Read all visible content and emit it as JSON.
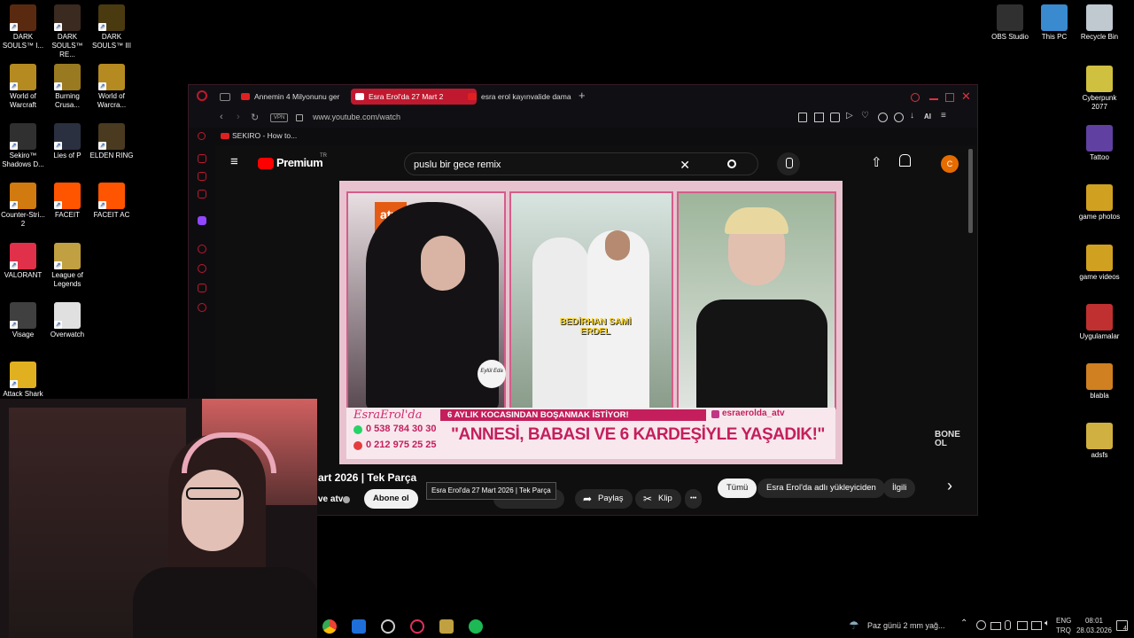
{
  "desktop": {
    "left_icons": [
      {
        "label": "DARK SOULS™ I...",
        "color": "#5a2a10"
      },
      {
        "label": "DARK SOULS™ RE...",
        "color": "#3a2a20"
      },
      {
        "label": "DARK SOULS™ III",
        "color": "#4a3a10"
      },
      {
        "label": "World of Warcraft",
        "color": "#b58a20"
      },
      {
        "label": "Burning Crusa...",
        "color": "#9a7a20"
      },
      {
        "label": "World of Warcra...",
        "color": "#b58a20"
      },
      {
        "label": "Sekiro™ Shadows D...",
        "color": "#303030"
      },
      {
        "label": "Lies of P",
        "color": "#2a3040"
      },
      {
        "label": "ELDEN RING",
        "color": "#4a3a20"
      },
      {
        "label": "Counter-Stri... 2",
        "color": "#d07a10"
      },
      {
        "label": "FACEIT",
        "color": "#ff5500"
      },
      {
        "label": "FACEIT AC",
        "color": "#ff5500"
      },
      {
        "label": "VALORANT",
        "color": "#e0304a"
      },
      {
        "label": "League of Legends",
        "color": "#c0a040"
      },
      {
        "label": "VISAGE",
        "color": "#404040"
      },
      {
        "label": "Visage",
        "color": "#404040"
      },
      {
        "label": "Overwatch",
        "color": "#e0e0e0"
      },
      {
        "label": "Attack Shark",
        "color": "#e0b020"
      }
    ],
    "right_icons": [
      {
        "label": "OBS Studio",
        "color": "#303030"
      },
      {
        "label": "This PC",
        "color": "#3a8ad0"
      },
      {
        "label": "Recycle Bin",
        "color": "#c0c8d0"
      },
      {
        "label": "Cyberpunk 2077",
        "color": "#d0c040"
      },
      {
        "label": "Tattoo",
        "color": "#6040a0"
      },
      {
        "label": "game photos",
        "color": "#d0a020"
      },
      {
        "label": "game videos",
        "color": "#d0a020"
      },
      {
        "label": "Uygulamalar",
        "color": "#c03030"
      },
      {
        "label": "blabla",
        "color": "#d08020"
      },
      {
        "label": "adsfs",
        "color": "#d0b040"
      }
    ]
  },
  "browser": {
    "tabs": [
      {
        "label": "Annemin 4 Milyonunu ger",
        "active": false
      },
      {
        "label": "Esra Erol'da 27 Mart 2",
        "active": true
      },
      {
        "label": "esra erol kayınvalide dama",
        "active": false
      }
    ],
    "new_tab_label": "+",
    "vpn_label": "VPN",
    "url": "www.youtube.com/watch",
    "ai_label": "AI",
    "bookmark": "SEKIRO - How to..."
  },
  "youtube": {
    "logo_text": "Premium",
    "logo_sup": "TR",
    "search_value": "puslu bir gece remix",
    "avatar_letter": "C",
    "video_title": "art 2026 | Tek Parça",
    "channel_name": "ve atv",
    "subscribe_label": "Abone ol",
    "tooltip": "Esra Erol'da 27 Mart 2026 | Tek Parça",
    "share_label": "Paylaş",
    "clip_label": "Klip",
    "more_label": "•••",
    "chips": [
      "Tümü",
      "Esra Erol'da adlı yükleyiciden",
      "İlgili"
    ],
    "next_label": "›"
  },
  "video_frame": {
    "channel_logo": "atv",
    "couple_caption": "BEDİRHAN SAMİ ERDEL",
    "badge_name": "Eylül Eda",
    "show_logo": "EsraErol'da",
    "phone1": "0 538 784 30 30",
    "phone2": "0 212 975 25 25",
    "headline_small": "6 AYLIK KOCASINDAN BOŞANMAK İSTİYOR!",
    "instagram": "esraerolda_atv",
    "headline_big": "\"ANNESİ, BABASI VE 6 KARDEŞİYLE YAŞADIK!\"",
    "watermark": "BONE OL"
  },
  "taskbar": {
    "weather": "Paz günü 2 mm yağ...",
    "lang_top": "ENG",
    "lang_bottom": "TRQ",
    "time": "08:01",
    "date": "28.03.2026",
    "notif_count": "4"
  }
}
